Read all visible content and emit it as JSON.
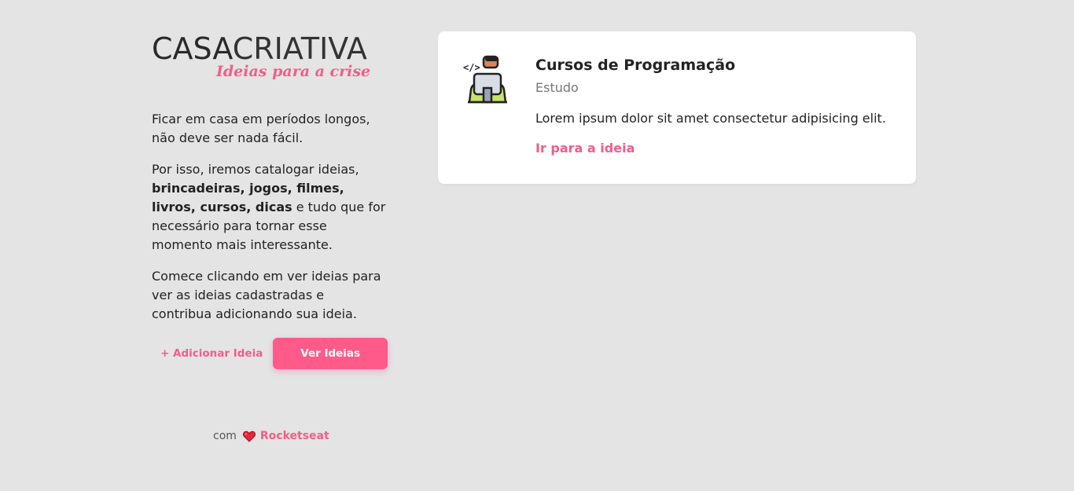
{
  "logo": {
    "part1": "CASA",
    "part2": "CRIATIVA",
    "tagline": "Ideias para a crise"
  },
  "intro": {
    "p1": "Ficar em casa em períodos longos, não deve ser nada fácil.",
    "p2_start": "Por isso, iremos catalogar ideias, ",
    "p2_bold": "brincadeiras, jogos, filmes, livros, cursos, dicas",
    "p2_end": " e tudo que for necessário para tornar esse momento mais interessante.",
    "p3": "Comece clicando em ver ideias para ver as ideias cadastradas e contribua adicionando sua ideia."
  },
  "actions": {
    "add_label": "+ Adicionar Ideia",
    "view_label": "Ver Ideias"
  },
  "footer": {
    "prefix": "com",
    "heart_icon": "heart-icon",
    "brand": "Rocketseat"
  },
  "ideas": [
    {
      "icon": "programmer-laptop-icon",
      "title": "Cursos de Programação",
      "category": "Estudo",
      "description": "Lorem ipsum dolor sit amet consectetur adipisicing elit.",
      "link_label": "Ir para a ideia"
    }
  ],
  "colors": {
    "background": "#e4e4e4",
    "accent": "#f25d8a",
    "button": "#ff5a89",
    "card": "#ffffff"
  }
}
